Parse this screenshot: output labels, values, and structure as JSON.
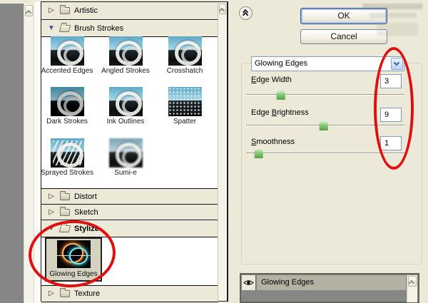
{
  "filter_list": {
    "categories": [
      {
        "label": "Artistic",
        "state": "collapsed"
      },
      {
        "label": "Brush Strokes",
        "state": "expanded"
      },
      {
        "label": "Distort",
        "state": "collapsed"
      },
      {
        "label": "Sketch",
        "state": "collapsed"
      },
      {
        "label": "Stylize",
        "state": "expanded"
      },
      {
        "label": "Texture",
        "state": "collapsed"
      }
    ],
    "brush_strokes_items": [
      "Accented Edges",
      "Angled Strokes",
      "Crosshatch",
      "Dark Strokes",
      "Ink Outlines",
      "Spatter",
      "Sprayed Strokes",
      "Sumi-e"
    ],
    "stylize_items": [
      "Glowing Edges"
    ],
    "selected_filter": "Glowing Edges"
  },
  "actions": {
    "ok": "OK",
    "cancel": "Cancel"
  },
  "filter_settings": {
    "selected_filter": "Glowing Edges",
    "sliders": [
      {
        "label_pre": "",
        "mnemonic": "E",
        "label_post": "dge Width",
        "value": "3",
        "percent": 22
      },
      {
        "label_pre": "Edge ",
        "mnemonic": "B",
        "label_post": "rightness",
        "value": "9",
        "percent": 49
      },
      {
        "label_pre": "",
        "mnemonic": "S",
        "label_post": "moothness",
        "value": "1",
        "percent": 8
      }
    ]
  },
  "effect_layers": {
    "rows": [
      {
        "label": "Glowing Edges",
        "visible": true
      }
    ]
  },
  "icons": {
    "collapsed_glyph": "▷",
    "expanded_glyph": "▼",
    "collapse_panel": "chevron-double-up",
    "dropdown": "chevron-down",
    "visibility": "eye"
  },
  "annotations": {
    "highlight_color": "#e01010",
    "circles": [
      "filter-settings-values-and-dropdown",
      "stylize-glowing-edges-thumbnail"
    ],
    "watermark_note": "illegible faint gray watermark"
  },
  "colors": {
    "bg": "#ece9d8",
    "field_border": "#7f9db9",
    "annotation_red": "#e01010",
    "fx_row_bg": "#b3b1a2",
    "preview_gray": "#868686"
  }
}
